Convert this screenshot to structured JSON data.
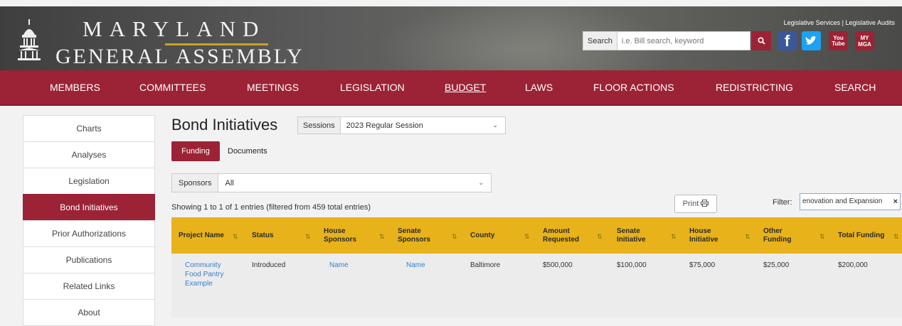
{
  "header": {
    "brand_line1": "MARYLAND",
    "brand_line2": "GENERAL ASSEMBLY",
    "top_links": "Legislative Services | Legislative Audits",
    "search_label": "Search",
    "search_placeholder": "i.e. Bill search, keyword",
    "social": {
      "youtube": "You Tube",
      "mga": "MY MGA"
    }
  },
  "nav": [
    "MEMBERS",
    "COMMITTEES",
    "MEETINGS",
    "LEGISLATION",
    "BUDGET",
    "LAWS",
    "FLOOR ACTIONS",
    "REDISTRICTING",
    "SEARCH"
  ],
  "sidebar": [
    "Charts",
    "Analyses",
    "Legislation",
    "Bond Initiatives",
    "Prior Authorizations",
    "Publications",
    "Related Links",
    "About"
  ],
  "page": {
    "title": "Bond Initiatives",
    "sessions_label": "Sessions",
    "sessions_value": "2023 Regular Session",
    "tab_funding": "Funding",
    "tab_documents": "Documents",
    "sponsors_label": "Sponsors",
    "sponsors_value": "All",
    "showing": "Showing 1 to 1 of 1 entries (filtered from 459 total entries)",
    "print": "Print",
    "filter_label": "Filter:",
    "filter_value": "enovation and Expansion"
  },
  "table": {
    "headers": [
      "Project Name",
      "Status",
      "House Sponsors",
      "Senate Sponsors",
      "County",
      "Amount Requested",
      "Senate Initiative",
      "House Initiative",
      "Other Funding",
      "Total Funding"
    ],
    "rows": [
      [
        "Community Food Pantry Example",
        "Introduced",
        "Name",
        "Name",
        "Baltimore",
        "$500,000",
        "$100,000",
        "$75,000",
        "$25,000",
        "$200,000"
      ]
    ]
  },
  "colors": {
    "accent": "#9b2335",
    "table_header": "#e8b21a",
    "link": "#3b7ec9"
  }
}
